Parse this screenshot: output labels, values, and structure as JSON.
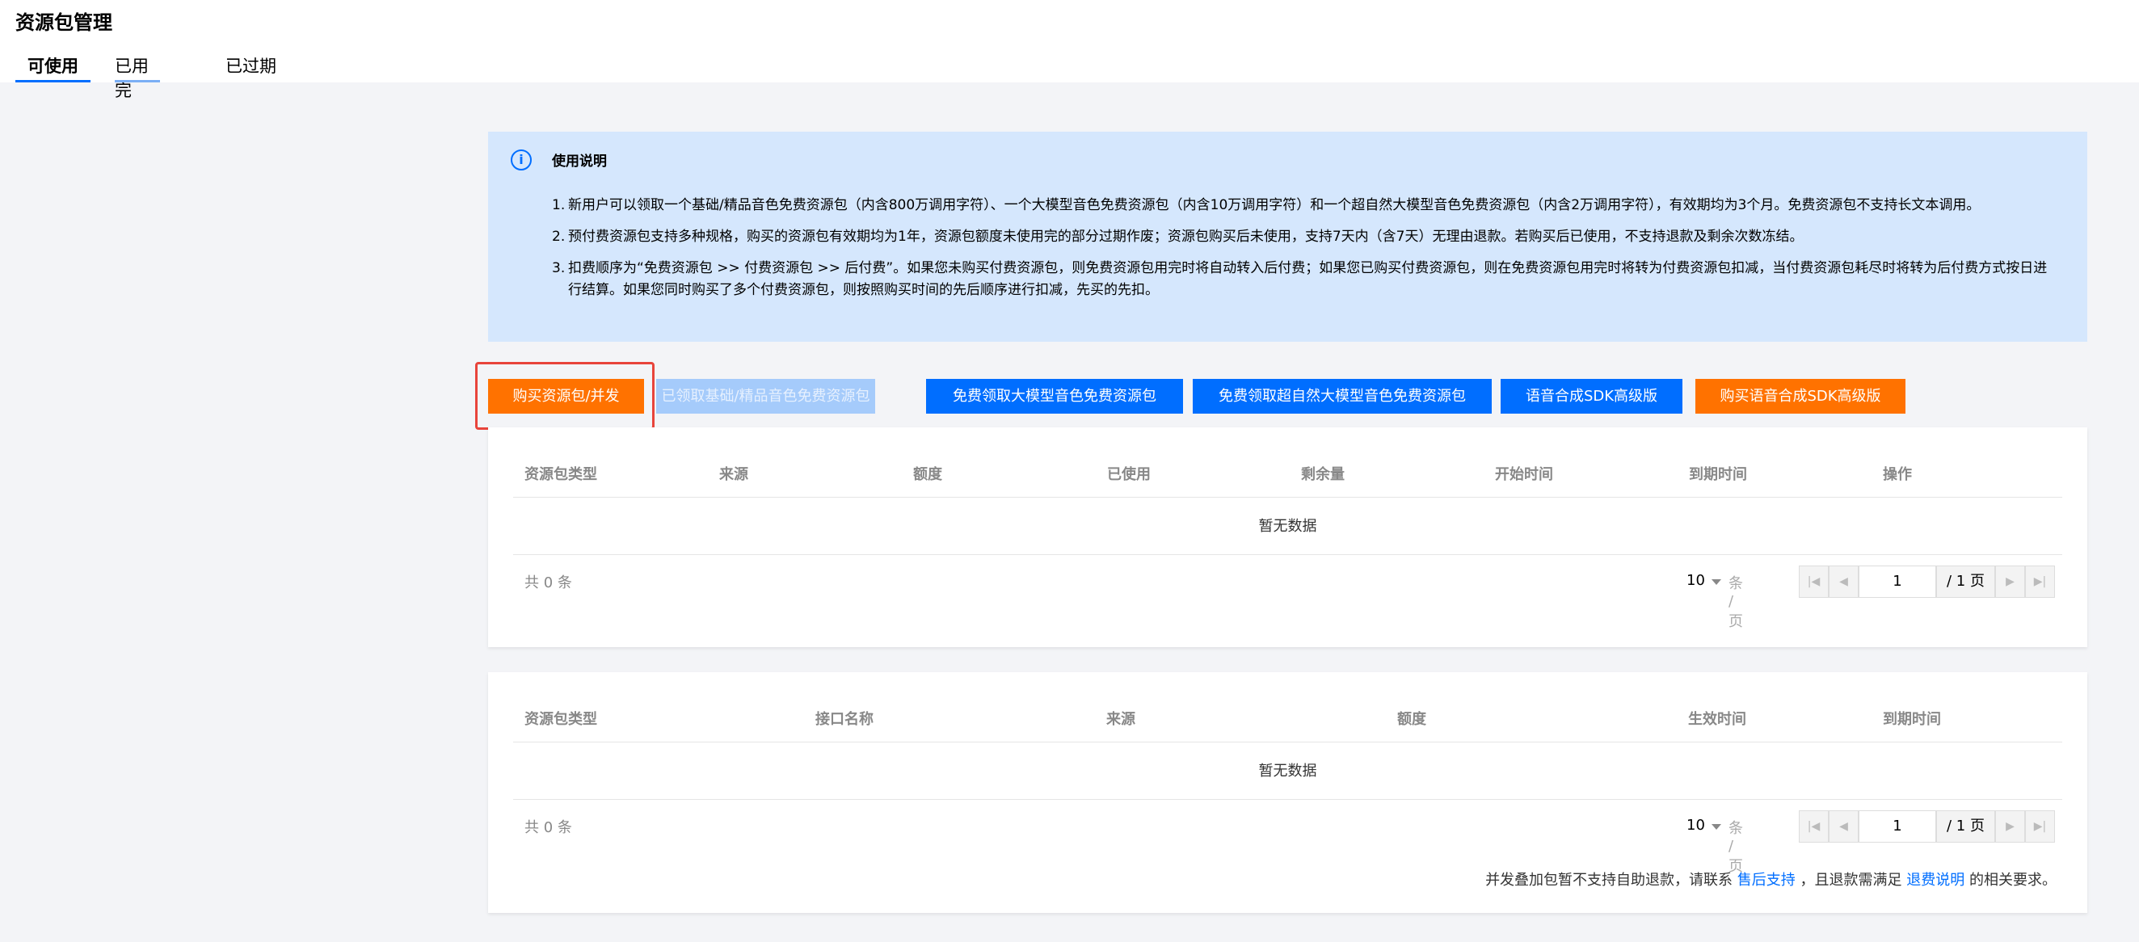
{
  "header": {
    "title": "资源包管理",
    "tabs": [
      {
        "label": "可使用"
      },
      {
        "label": "已用完"
      },
      {
        "label": "已过期"
      }
    ]
  },
  "notice": {
    "icon": "info-icon",
    "title": "使用说明",
    "items": [
      {
        "num": "1.",
        "text": "新用户可以领取一个基础/精品音色免费资源包（内含800万调用字符）、一个大模型音色免费资源包（内含10万调用字符）和一个超自然大模型音色免费资源包（内含2万调用字符），有效期均为3个月。免费资源包不支持长文本调用。"
      },
      {
        "num": "2.",
        "text": "预付费资源包支持多种规格，购买的资源包有效期均为1年，资源包额度未使用完的部分过期作废；资源包购买后未使用，支持7天内（含7天）无理由退款。若购买后已使用，不支持退款及剩余次数冻结。"
      },
      {
        "num": "3.",
        "text": "扣费顺序为“免费资源包 >> 付费资源包 >> 后付费”。如果您未购买付费资源包，则免费资源包用完时将自动转入后付费；如果您已购买付费资源包，则在免费资源包用完时将转为付费资源包扣减，当付费资源包耗尽时将转为后付费方式按日进行结算。如果您同时购买了多个付费资源包，则按照购买时间的先后顺序进行扣减，先买的先扣。"
      }
    ]
  },
  "buttons": {
    "buy": "购买资源包/并发",
    "claimed_basic": "已领取基础/精品音色免费资源包",
    "claim_llm": "免费领取大模型音色免费资源包",
    "claim_super": "免费领取超自然大模型音色免费资源包",
    "sdk_advanced": "语音合成SDK高级版",
    "buy_sdk": "购买语音合成SDK高级版"
  },
  "table1": {
    "columns": [
      "资源包类型",
      "来源",
      "额度",
      "已使用",
      "剩余量",
      "开始时间",
      "到期时间",
      "操作"
    ],
    "empty": "暂无数据",
    "total": "共 0 条",
    "page_size": "10",
    "per_page": "条 / 页",
    "page": "1",
    "page_total": "/ 1 页"
  },
  "table2": {
    "columns": [
      "资源包类型",
      "接口名称",
      "来源",
      "额度",
      "生效时间",
      "到期时间"
    ],
    "empty": "暂无数据",
    "total": "共 0 条",
    "page_size": "10",
    "per_page": "条 / 页",
    "page": "1",
    "page_total": "/ 1 页",
    "refund_pre": "并发叠加包暂不支持自助退款，请联系",
    "refund_link1": "售后支持",
    "refund_mid": "，且退款需满足",
    "refund_link2": "退费说明",
    "refund_post": "的相关要求。"
  },
  "colors": {
    "accent": "#006eff",
    "orange": "#ff7200",
    "notice_bg": "#d5e7fd",
    "highlight": "#e8443b"
  }
}
